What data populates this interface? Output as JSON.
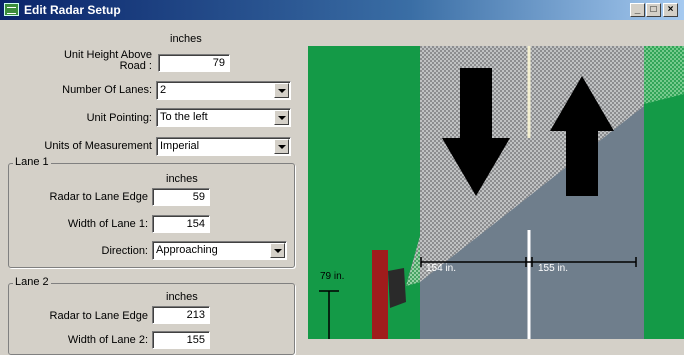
{
  "window": {
    "title": "Edit Radar Setup",
    "controls": {
      "minimize": "_",
      "maximize": "□",
      "close": "×"
    }
  },
  "form": {
    "units_header": "inches",
    "unit_height": {
      "label": "Unit Height Above Road :",
      "value": "79"
    },
    "number_of_lanes": {
      "label": "Number Of Lanes:",
      "value": "2"
    },
    "unit_pointing": {
      "label": "Unit Pointing:",
      "value": "To the left"
    },
    "units_of_measurement": {
      "label": "Units of Measurement",
      "value": "Imperial"
    }
  },
  "lane1": {
    "title": "Lane 1",
    "units": "inches",
    "radar_to_lane_edge": {
      "label": "Radar to Lane Edge",
      "value": "59"
    },
    "width_of_lane": {
      "label": "Width of Lane  1:",
      "value": "154"
    },
    "direction": {
      "label": "Direction:",
      "value": "Approaching"
    }
  },
  "lane2": {
    "title": "Lane 2",
    "units": "inches",
    "radar_to_lane_edge": {
      "label": "Radar to Lane Edge",
      "value": "213"
    },
    "width_of_lane": {
      "label": "Width of Lane  2:",
      "value": "155"
    }
  },
  "diagram": {
    "height_label": "79 in.",
    "lane1_label": "154 in.",
    "lane2_label": "155 in.",
    "colors": {
      "grass": "#149a47",
      "road": "#6f7e8c",
      "pole": "#a01c1c",
      "beam": "#c8c8c8"
    },
    "arrows": [
      "arrow-down-icon",
      "arrow-up-icon"
    ]
  }
}
